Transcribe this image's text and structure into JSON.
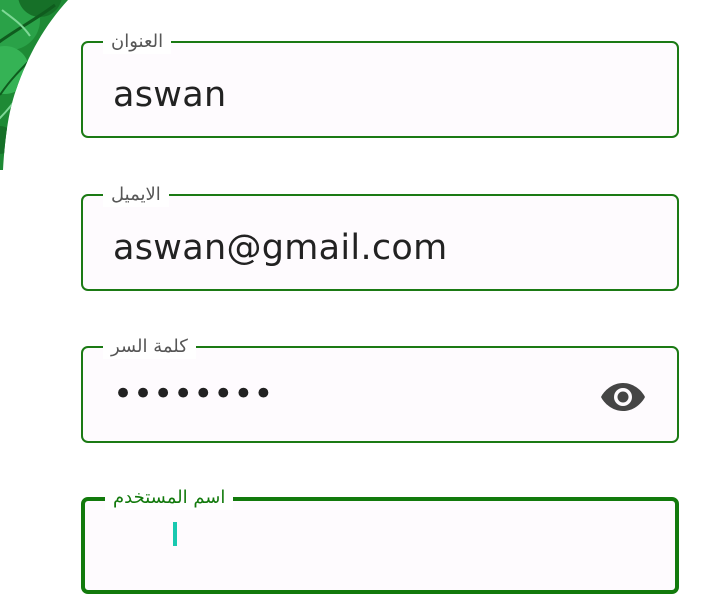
{
  "fields": [
    {
      "label": "العنوان",
      "value": "aswan"
    },
    {
      "label": "الايميل",
      "value": "aswan@gmail.com"
    },
    {
      "label": "كلمة السر",
      "value": "••••••••",
      "toggle_icon": "eye-icon"
    },
    {
      "label": "اسم المستخدم",
      "value": "",
      "focused": true
    }
  ],
  "colors": {
    "border": "#1b7a14",
    "focused_border": "#127a0c",
    "field_background": "#fefbfe",
    "cursor": "#19c9b0",
    "decoration": "#1e8a35"
  }
}
